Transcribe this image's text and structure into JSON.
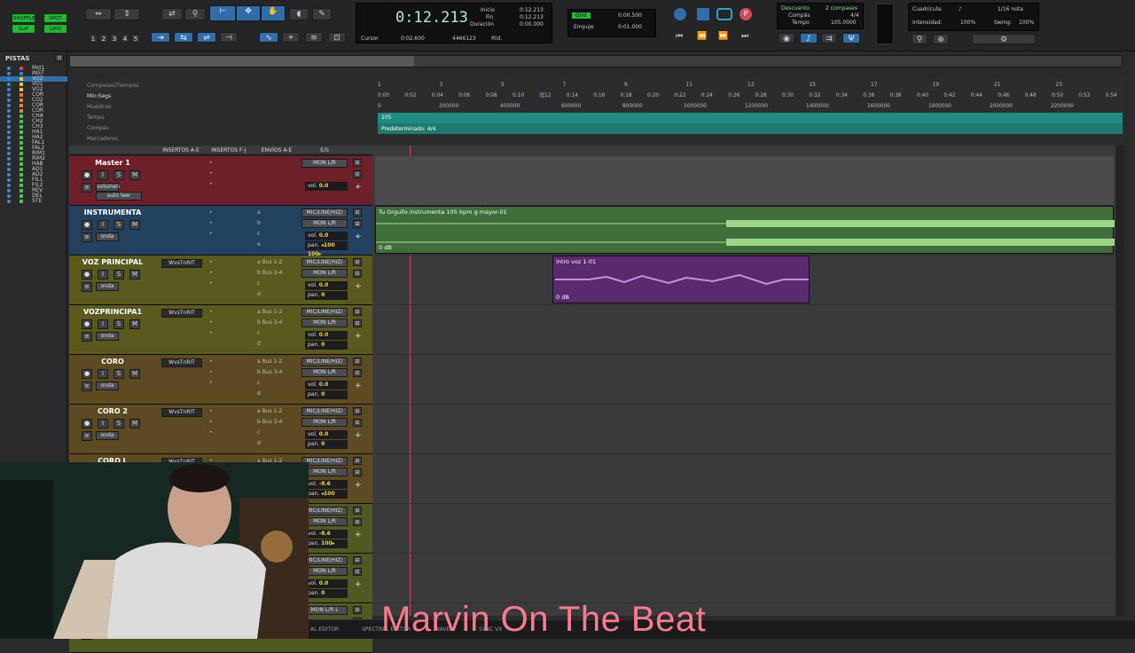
{
  "toolbar": {
    "modes": [
      "SHUFFLE",
      "SPOT",
      "SLIP",
      "GRID"
    ],
    "zoom_presets": [
      "1",
      "2",
      "3",
      "4",
      "5"
    ],
    "counter": {
      "main": "0:12.213",
      "labels": [
        "Inicio",
        "Fin",
        "Duración"
      ],
      "values": [
        "0:12.213",
        "0:12.213",
        "0:00.000"
      ],
      "cursor_label": "Cursor",
      "cursor_value": "0:02.600",
      "sample_value": "4466123",
      "rtd": "Rtd."
    },
    "grid": {
      "label": "Grid",
      "value": "0:00.500",
      "nudge_label": "Empuje",
      "nudge_value": "0:01.000"
    },
    "transport": {
      "descuento": "Descuento",
      "compas": "Compás",
      "tempo": "Tempo",
      "compases": "2 compases",
      "sig": "4/4",
      "bpm": "105.0000"
    },
    "groove": {
      "cuadricula": "Cuadrícula:",
      "note": "1/16 nota",
      "intensidad": "Intensidad:",
      "int_val": "100%",
      "swing": "Swing:",
      "swing_val": "100%"
    }
  },
  "tracklist": {
    "title": "PISTAS",
    "items": [
      {
        "name": "Mst1",
        "color": "#d94040"
      },
      {
        "name": "INST",
        "color": "#3b7bd1"
      },
      {
        "name": "VOZ",
        "color": "#e6c24a"
      },
      {
        "name": "VO1",
        "color": "#e6c24a"
      },
      {
        "name": "VO2",
        "color": "#e6c24a"
      },
      {
        "name": "COR",
        "color": "#d98a3a"
      },
      {
        "name": "CO2",
        "color": "#d98a3a"
      },
      {
        "name": "COR",
        "color": "#d98a3a"
      },
      {
        "name": "COR",
        "color": "#d98a3a"
      },
      {
        "name": "CHA",
        "color": "#4ac24a"
      },
      {
        "name": "CH2",
        "color": "#4ac24a"
      },
      {
        "name": "CH3",
        "color": "#4ac24a"
      },
      {
        "name": "HA1",
        "color": "#4ac24a"
      },
      {
        "name": "HA2",
        "color": "#4ac24a"
      },
      {
        "name": "FAL1",
        "color": "#4ac24a"
      },
      {
        "name": "FAL2",
        "color": "#4ac24a"
      },
      {
        "name": "RIM1",
        "color": "#4ac24a"
      },
      {
        "name": "RIM2",
        "color": "#4ac24a"
      },
      {
        "name": "HAB",
        "color": "#4ac24a"
      },
      {
        "name": "AD1",
        "color": "#4ac24a"
      },
      {
        "name": "AD2",
        "color": "#4ac24a"
      },
      {
        "name": "FIL1",
        "color": "#4ac24a"
      },
      {
        "name": "FIL2",
        "color": "#4ac24a"
      },
      {
        "name": "REV",
        "color": "#4ac24a"
      },
      {
        "name": "DEL",
        "color": "#4ac24a"
      },
      {
        "name": "STE",
        "color": "#4ac24a"
      }
    ]
  },
  "rulers": {
    "labels": [
      "Compases|Tiempos",
      "Min:Segs",
      "Muestras",
      "Tempo",
      "Compás",
      "Marcadores"
    ],
    "bars": [
      "1",
      "3",
      "5",
      "7",
      "9",
      "11",
      "13",
      "15",
      "17",
      "19",
      "21",
      "23"
    ],
    "mins": [
      "0:00",
      "0:02",
      "0:04",
      "0:06",
      "0:08",
      "0:10",
      "0:12",
      "0:14",
      "0:16",
      "0:18",
      "0:20",
      "0:22",
      "0:24",
      "0:26",
      "0:28",
      "0:30",
      "0:32",
      "0:34",
      "0:36",
      "0:38",
      "0:40",
      "0:42",
      "0:44",
      "0:46",
      "0:48",
      "0:50",
      "0:52",
      "0:54"
    ],
    "samples": [
      "0",
      "200000",
      "400000",
      "600000",
      "800000",
      "1000000",
      "1200000",
      "1400000",
      "1600000",
      "1800000",
      "2000000",
      "2200000"
    ],
    "tempo_marker": "105",
    "meter": "Predeterminado: 4/4"
  },
  "columns": [
    "INSERTOS A-E",
    "INSERTOS F-J",
    "ENVÍOS A-E",
    "E/S"
  ],
  "tracks": [
    {
      "name": "Master 1",
      "color": "#6d1f2a",
      "io": "MON L/R",
      "io2": "",
      "vol": "0.0",
      "pan": "",
      "sends": [],
      "inserts": "",
      "extra": [
        "volumen",
        "auto leer"
      ]
    },
    {
      "name": "INSTRUMENTA",
      "color": "#24405f",
      "io": "MIC/LINE/HIZ/",
      "io2": "MON L/R",
      "vol": "0.0",
      "pan": "◂100  100▸",
      "sends": [
        "a",
        "b",
        "c",
        "e"
      ],
      "inserts": "",
      "extra": [
        "onda"
      ]
    },
    {
      "name": "VOZ PRINCIPAL",
      "color": "#5a5a1e",
      "io": "MIC/LINE/HIZ/",
      "io2": "MON L/R",
      "vol": "0.0",
      "pan": "0",
      "sends": [
        "a Bus 1-2",
        "b Bus 3-4",
        "c",
        "d"
      ],
      "inserts": "WvsTnRIT",
      "extra": [
        "onda"
      ]
    },
    {
      "name": "VOZPRINCIPA1",
      "color": "#5a5a1e",
      "io": "MIC/LINE/HIZ/",
      "io2": "MON L/R",
      "vol": "0.0",
      "pan": "0",
      "sends": [
        "a Bus 1-2",
        "b Bus 3-4",
        "c",
        "d"
      ],
      "inserts": "WvsTnRIT",
      "extra": [
        "onda"
      ]
    },
    {
      "name": "CORO",
      "color": "#5e4a22",
      "io": "MIC/LINE/HIZ/",
      "io2": "MON L/R",
      "vol": "0.0",
      "pan": "0",
      "sends": [
        "a Bus 1-2",
        "b Bus 3-4",
        "c",
        "d"
      ],
      "inserts": "WvsTnRIT",
      "extra": [
        "onda"
      ]
    },
    {
      "name": "CORO 2",
      "color": "#5e4a22",
      "io": "MIC/LINE/HIZ/",
      "io2": "MON L/R",
      "vol": "0.0",
      "pan": "0",
      "sends": [
        "a Bus 1-2",
        "b Bus 3-4",
        "c",
        "d"
      ],
      "inserts": "WvsTnRIT",
      "extra": [
        "onda"
      ]
    },
    {
      "name": "CORO L",
      "color": "#5e4a22",
      "io": "MIC/LINE/HIZ/",
      "io2": "MON L/R",
      "vol": "-8.6",
      "pan": "◂100",
      "sends": [
        "a Bus 1-2"
      ],
      "inserts": "WvsTnRIT",
      "extra": []
    },
    {
      "name": "",
      "color": "#4e5a22",
      "io": "MIC/LINE/HIZ/",
      "io2": "MON L/R",
      "vol": "-8.6",
      "pan": "100▸",
      "sends": [],
      "inserts": "",
      "extra": []
    },
    {
      "name": "",
      "color": "#4e5a22",
      "io": "MIC/LINE/HIZ/",
      "io2": "MON L/R",
      "vol": "0.0",
      "pan": "0",
      "sends": [],
      "inserts": "",
      "extra": []
    },
    {
      "name": "",
      "color": "#4e5a22",
      "io": "MON L/R L",
      "io2": "",
      "vol": "",
      "pan": "",
      "sends": [],
      "inserts": "",
      "extra": []
    }
  ],
  "clips": {
    "instrumental": {
      "title": "Tu Orgullo instrumenta 105 bpm g mayor-01",
      "gain": "0 dB"
    },
    "voz": {
      "title": "intro voz 1-01",
      "gain": "0 dB"
    }
  },
  "bottom": {
    "tabs": [
      "AL EDITOR",
      "SPECTRAL EDITOR",
      "WAVES",
      "SYNC VX"
    ]
  },
  "overlay": {
    "banner": "Marvin On The Beat"
  },
  "colors": {
    "accent_blue": "#2f6ea8",
    "grid_green": "#27b83a",
    "clip_green": "#3f6e3a",
    "clip_purple": "#5a2a6e",
    "playhead": "#e6405a"
  }
}
